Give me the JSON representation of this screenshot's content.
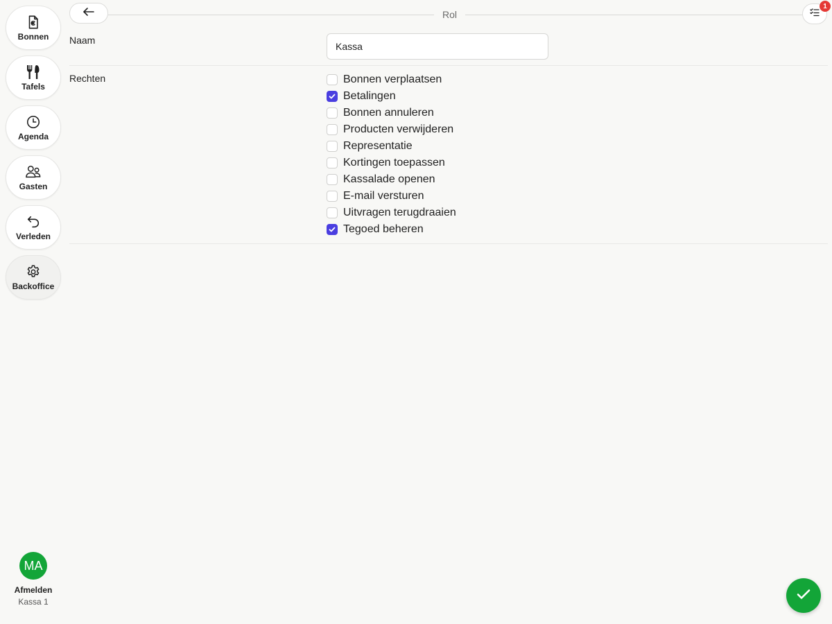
{
  "sidebar": {
    "items": [
      {
        "label": "Bonnen",
        "icon": "receipt-euro-icon"
      },
      {
        "label": "Tafels",
        "icon": "cutlery-icon"
      },
      {
        "label": "Agenda",
        "icon": "clock-icon"
      },
      {
        "label": "Gasten",
        "icon": "users-icon"
      },
      {
        "label": "Verleden",
        "icon": "undo-arrow-icon"
      },
      {
        "label": "Backoffice",
        "icon": "gear-icon",
        "active": true
      }
    ],
    "user": {
      "initials": "MA",
      "logout_label": "Afmelden",
      "register": "Kassa 1"
    }
  },
  "header": {
    "title": "Rol",
    "back_icon": "arrow-left-icon",
    "list_icon": "checklist-icon",
    "badge_count": "1"
  },
  "form": {
    "name_label": "Naam",
    "name_value": "Kassa",
    "rights_label": "Rechten",
    "permissions": [
      {
        "label": "Bonnen verplaatsen",
        "checked": false
      },
      {
        "label": "Betalingen",
        "checked": true
      },
      {
        "label": "Bonnen annuleren",
        "checked": false
      },
      {
        "label": "Producten verwijderen",
        "checked": false
      },
      {
        "label": "Representatie",
        "checked": false
      },
      {
        "label": "Kortingen toepassen",
        "checked": false
      },
      {
        "label": "Kassalade openen",
        "checked": false
      },
      {
        "label": "E-mail versturen",
        "checked": false
      },
      {
        "label": "Uitvragen terugdraaien",
        "checked": false
      },
      {
        "label": "Tegoed beheren",
        "checked": true
      }
    ]
  },
  "actions": {
    "save_icon": "checkmark-icon"
  },
  "colors": {
    "accent_green": "#13a538",
    "checkbox_checked": "#4a3ee0",
    "badge_red": "#e53935",
    "background": "#f8f8f6"
  }
}
